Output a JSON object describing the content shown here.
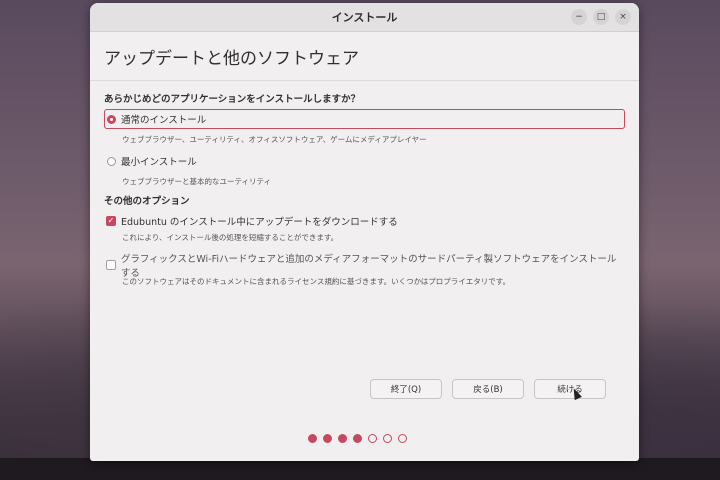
{
  "window": {
    "title": "インストール",
    "controls": {
      "minimize": "−",
      "maximize": "□",
      "close": "×"
    }
  },
  "header": {
    "title": "アップデートと他のソフトウェア"
  },
  "install_type": {
    "question": "あらかじめどのアプリケーションをインストールしますか？",
    "options": [
      {
        "label": "通常のインストール",
        "description": "ウェブブラウザー、ユーティリティ、オフィスソフトウェア、ゲームにメディアプレイヤー",
        "selected": true
      },
      {
        "label": "最小インストール",
        "description": "ウェブブラウザーと基本的なユーティリティ",
        "selected": false
      }
    ]
  },
  "other_options": {
    "heading": "その他のオプション",
    "items": [
      {
        "label": "Edubuntu のインストール中にアップデートをダウンロードする",
        "description": "これにより、インストール後の処理を短縮することができます。",
        "checked": true
      },
      {
        "label": "グラフィックスとWi-Fiハードウェアと追加のメディアフォーマットのサードパーティ製ソフトウェアをインストールする",
        "description": "このソフトウェアはそのドキュメントに含まれるライセンス規約に基づきます。いくつかはプロプライエタリです。",
        "checked": false
      }
    ]
  },
  "buttons": {
    "quit": "終了(Q)",
    "back": "戻る(B)",
    "continue": "続ける"
  },
  "progress": {
    "total_steps": 7,
    "current_step": 4
  },
  "colors": {
    "accent": "#c7485f"
  }
}
